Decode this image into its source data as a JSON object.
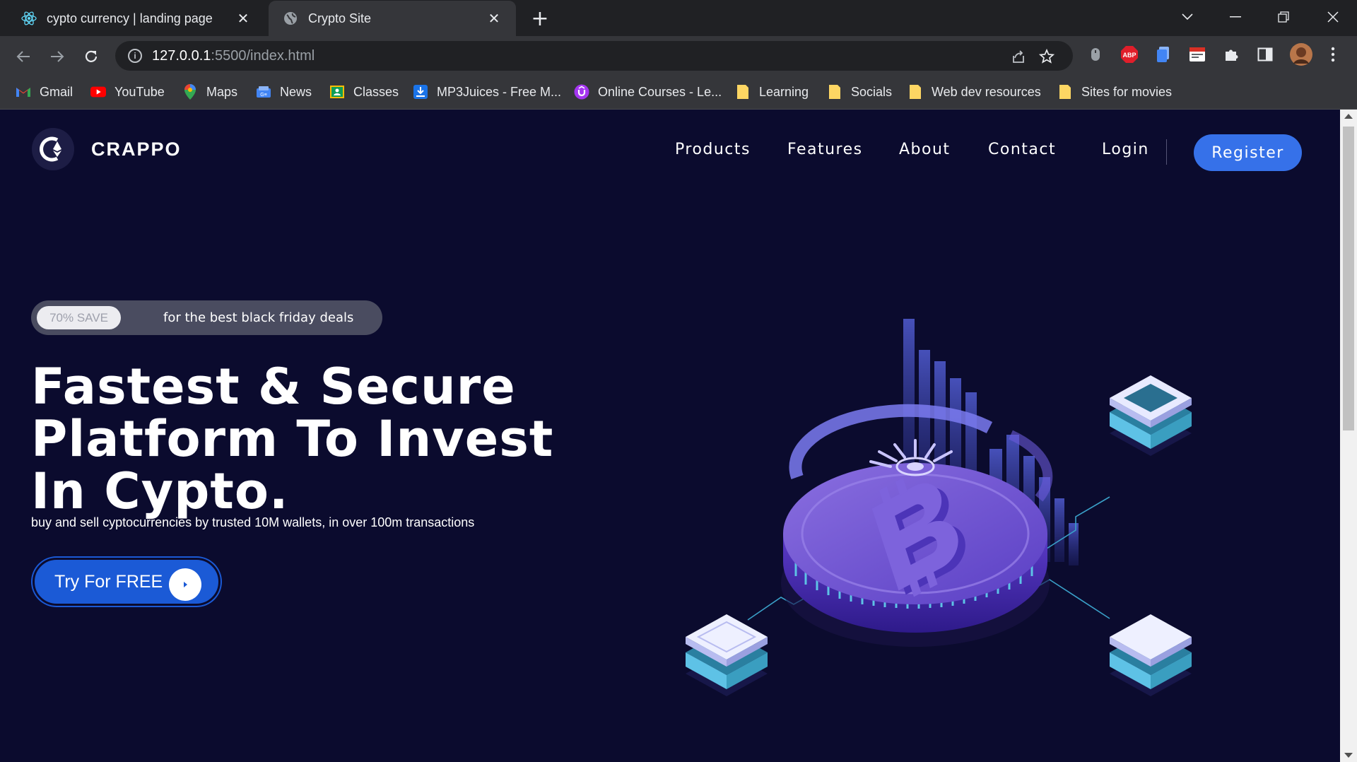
{
  "browser": {
    "tabs": [
      {
        "title": "cypto currency | landing page",
        "active": false
      },
      {
        "title": "Crypto Site",
        "active": true
      }
    ],
    "url_host": "127.0.0.1",
    "url_path": ":5500/index.html",
    "bookmarks": [
      {
        "label": "Gmail",
        "icon": "gmail-icon"
      },
      {
        "label": "YouTube",
        "icon": "youtube-icon"
      },
      {
        "label": "Maps",
        "icon": "maps-icon"
      },
      {
        "label": "News",
        "icon": "news-icon"
      },
      {
        "label": "Classes",
        "icon": "classes-icon"
      },
      {
        "label": "MP3Juices - Free M...",
        "icon": "download-icon"
      },
      {
        "label": "Online Courses - Le...",
        "icon": "udemy-icon"
      },
      {
        "label": "Learning",
        "icon": "folder-icon"
      },
      {
        "label": "Socials",
        "icon": "folder-icon"
      },
      {
        "label": "Web dev resources",
        "icon": "folder-icon"
      },
      {
        "label": "Sites for movies",
        "icon": "folder-icon"
      }
    ],
    "extension_abp_label": "ABP"
  },
  "site": {
    "brand": "CRAPPO",
    "nav": [
      "Products",
      "Features",
      "About",
      "Contact"
    ],
    "login": "Login",
    "register": "Register",
    "promo_badge": "70% SAVE",
    "promo_text": "for the best black friday deals",
    "hero_title": "Fastest & Secure Platform To Invest In Cypto.",
    "hero_subtitle": "buy and sell cyptocurrencies by trusted 10M wallets, in over 100m transactions",
    "cta_label": "Try For FREE"
  },
  "colors": {
    "page_bg": "#0b0b2e",
    "accent": "#3671e9",
    "cta": "#1b5ad6",
    "promo_bg": "#4a4c60"
  }
}
